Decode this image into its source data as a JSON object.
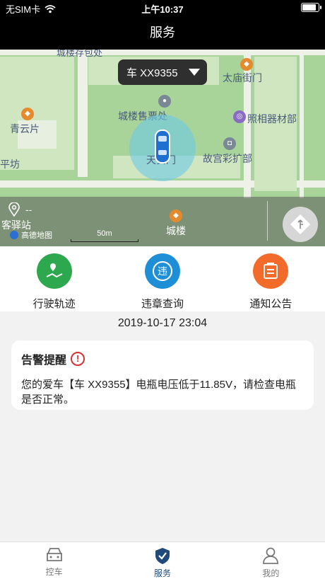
{
  "status_bar": {
    "carrier": "无SIM卡",
    "time": "上午10:37"
  },
  "header": {
    "title": "服务"
  },
  "map": {
    "selected_car": "车 XX9355",
    "labels": {
      "chenglou_top": "城楼存包处",
      "taimiao": "太庙街门",
      "qingyun": "青云片",
      "chenglou_ticket": "城楼售票处",
      "zhaoxiang": "照相器材部",
      "tianmen": "天安门",
      "pingfang": "平坊",
      "gugong": "故宫彩扩部",
      "kezhan": "客驿站",
      "chenglou": "城楼"
    },
    "location_text": "--",
    "scale": "50m",
    "brand": "高德地图"
  },
  "actions": [
    {
      "label": "行驶轨迹",
      "color": "#2ea84f",
      "icon": "track-icon"
    },
    {
      "label": "违章查询",
      "color": "#1e8fd6",
      "icon": "violation-icon"
    },
    {
      "label": "通知公告",
      "color": "#f26b2a",
      "icon": "notice-icon"
    }
  ],
  "alert": {
    "date": "2019-10-17 23:04",
    "title": "告警提醒",
    "icon_glyph": "!",
    "message": "您的爱车【车 XX9355】电瓶电压低于11.85V，请检查电瓶是否正常。"
  },
  "tabs": [
    {
      "label": "控车",
      "icon": "car-icon",
      "active": false
    },
    {
      "label": "服务",
      "icon": "shield-check-icon",
      "active": true
    },
    {
      "label": "我的",
      "icon": "user-icon",
      "active": false
    }
  ]
}
